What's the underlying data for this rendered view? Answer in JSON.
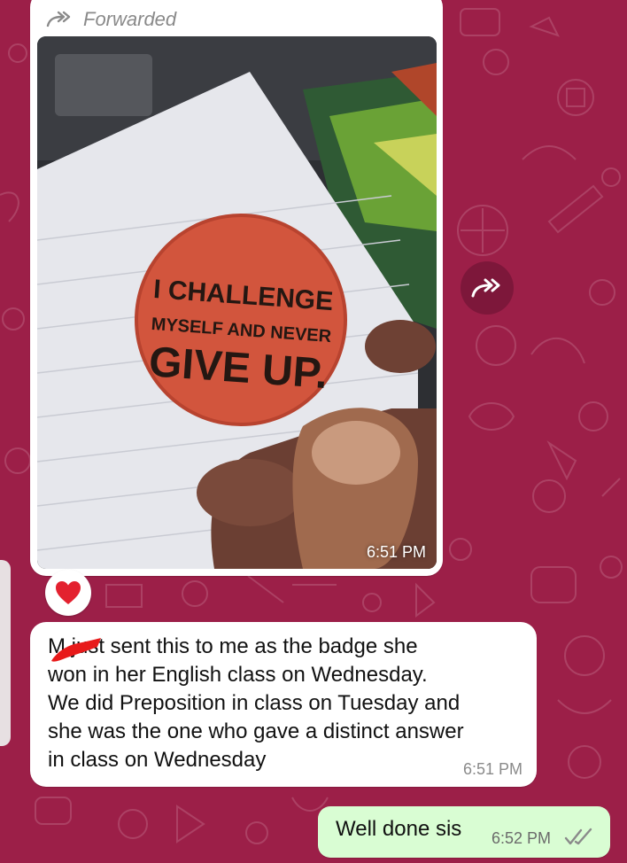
{
  "colors": {
    "wallpaper": "#9c1f48",
    "incoming_bubble": "#ffffff",
    "outgoing_bubble": "#d9fdd3",
    "read_ticks": "#8a8a8a"
  },
  "forwarded_message": {
    "label": "Forwarded",
    "icon": "forwarded-arrows-icon",
    "photo_badge_text": [
      "I CHALLENGE",
      "MYSELF AND NEVER",
      "GIVE UP."
    ],
    "time": "6:51 PM",
    "reaction": "❤️"
  },
  "incoming_message": {
    "text": "M   just sent this to me as the badge she\nwon in her English class on Wednesday.\nWe did Preposition in class on Tuesday and\nshe was the one who gave a distinct answer\nin class on Wednesday",
    "time": "6:51 PM"
  },
  "outgoing_message": {
    "text": "Well done sis",
    "time": "6:52 PM",
    "status_icon": "double-check-icon"
  },
  "forward_button_icon": "forward-icon"
}
